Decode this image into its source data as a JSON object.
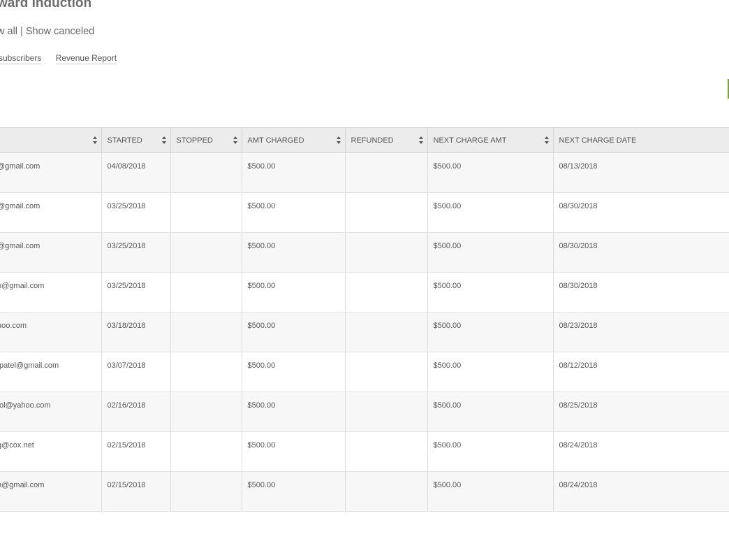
{
  "page": {
    "title": "ward Induction",
    "filters": {
      "show_all": "w all",
      "separator": "|",
      "show_canceled": "Show canceled"
    },
    "links": {
      "subscribers": "subscribers",
      "revenue_report": "Revenue Report"
    },
    "accent_color": "#7aa33a"
  },
  "table": {
    "columns": [
      {
        "key": "email",
        "label": ""
      },
      {
        "key": "started",
        "label": "STARTED"
      },
      {
        "key": "stopped",
        "label": "STOPPED"
      },
      {
        "key": "amt_charged",
        "label": "AMT CHARGED"
      },
      {
        "key": "refunded",
        "label": "REFUNDED"
      },
      {
        "key": "next_charge_amt",
        "label": "NEXT CHARGE AMT"
      },
      {
        "key": "next_charge_date",
        "label": "NEXT CHARGE DATE"
      }
    ],
    "rows": [
      {
        "email": "@gmail.com",
        "started": "04/08/2018",
        "stopped": "",
        "amt_charged": "$500.00",
        "refunded": "",
        "next_charge_amt": "$500.00",
        "next_charge_date": "08/13/2018"
      },
      {
        "email": "@gmail.com",
        "started": "03/25/2018",
        "stopped": "",
        "amt_charged": "$500.00",
        "refunded": "",
        "next_charge_amt": "$500.00",
        "next_charge_date": "08/30/2018"
      },
      {
        "email": "@gmail.com",
        "started": "03/25/2018",
        "stopped": "",
        "amt_charged": "$500.00",
        "refunded": "",
        "next_charge_amt": "$500.00",
        "next_charge_date": "08/30/2018"
      },
      {
        "email": "n@gmail.com",
        "started": "03/25/2018",
        "stopped": "",
        "amt_charged": "$500.00",
        "refunded": "",
        "next_charge_amt": "$500.00",
        "next_charge_date": "08/30/2018"
      },
      {
        "email": "hoo.com",
        "started": "03/18/2018",
        "stopped": "",
        "amt_charged": "$500.00",
        "refunded": "",
        "next_charge_amt": "$500.00",
        "next_charge_date": "08/23/2018"
      },
      {
        "email": ".patel@gmail.com",
        "started": "03/07/2018",
        "stopped": "",
        "amt_charged": "$500.00",
        "refunded": "",
        "next_charge_amt": "$500.00",
        "next_charge_date": "08/12/2018"
      },
      {
        "email": "tol@yahoo.com",
        "started": "02/16/2018",
        "stopped": "",
        "amt_charged": "$500.00",
        "refunded": "",
        "next_charge_amt": "$500.00",
        "next_charge_date": "08/25/2018"
      },
      {
        "email": "g@cox.net",
        "started": "02/15/2018",
        "stopped": "",
        "amt_charged": "$500.00",
        "refunded": "",
        "next_charge_amt": "$500.00",
        "next_charge_date": "08/24/2018"
      },
      {
        "email": "n@gmail.com",
        "started": "02/15/2018",
        "stopped": "",
        "amt_charged": "$500.00",
        "refunded": "",
        "next_charge_amt": "$500.00",
        "next_charge_date": "08/24/2018"
      }
    ],
    "sort_icon": "sort-updown-icon"
  }
}
